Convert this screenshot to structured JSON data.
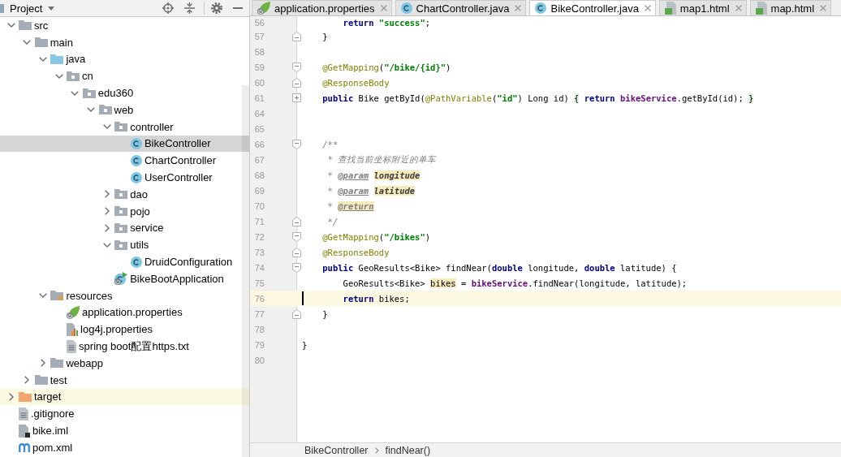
{
  "project_panel": {
    "title": "Project",
    "tree": [
      {
        "label": "src",
        "kind": "folder",
        "expanded": true,
        "selected": false,
        "children": [
          {
            "label": "main",
            "kind": "folder",
            "expanded": true,
            "selected": false,
            "children": [
              {
                "label": "java",
                "kind": "source-root",
                "expanded": true,
                "selected": false,
                "children": [
                  {
                    "label": "cn",
                    "kind": "package",
                    "expanded": true,
                    "selected": false,
                    "children": [
                      {
                        "label": "edu360",
                        "kind": "package",
                        "expanded": true,
                        "selected": false,
                        "children": [
                          {
                            "label": "web",
                            "kind": "package",
                            "expanded": true,
                            "selected": false,
                            "children": [
                              {
                                "label": "controller",
                                "kind": "package",
                                "expanded": true,
                                "selected": false,
                                "children": [
                                  {
                                    "label": "BikeController",
                                    "kind": "class",
                                    "selected": true
                                  },
                                  {
                                    "label": "ChartController",
                                    "kind": "class",
                                    "selected": false
                                  },
                                  {
                                    "label": "UserController",
                                    "kind": "class",
                                    "selected": false
                                  }
                                ]
                              },
                              {
                                "label": "dao",
                                "kind": "package",
                                "expanded": false,
                                "selected": false
                              },
                              {
                                "label": "pojo",
                                "kind": "package",
                                "expanded": false,
                                "selected": false
                              },
                              {
                                "label": "service",
                                "kind": "package",
                                "expanded": false,
                                "selected": false
                              },
                              {
                                "label": "utils",
                                "kind": "package",
                                "expanded": true,
                                "selected": false,
                                "children": [
                                  {
                                    "label": "DruidConfiguration",
                                    "kind": "class",
                                    "selected": false
                                  }
                                ]
                              },
                              {
                                "label": "BikeBootApplication",
                                "kind": "boot-app",
                                "selected": false
                              }
                            ]
                          }
                        ]
                      }
                    ]
                  }
                ]
              },
              {
                "label": "resources",
                "kind": "resources-root",
                "expanded": true,
                "selected": false,
                "children": [
                  {
                    "label": "application.properties",
                    "kind": "spring-properties",
                    "selected": false
                  },
                  {
                    "label": "log4j.properties",
                    "kind": "properties",
                    "selected": false
                  },
                  {
                    "label": "spring boot配置https.txt",
                    "kind": "text",
                    "selected": false
                  }
                ]
              },
              {
                "label": "webapp",
                "kind": "folder",
                "expanded": false,
                "selected": false
              }
            ]
          },
          {
            "label": "test",
            "kind": "folder",
            "expanded": false,
            "selected": false
          }
        ]
      },
      {
        "label": "target",
        "kind": "excluded-folder",
        "expanded": false,
        "selected": false
      },
      {
        "label": ".gitignore",
        "kind": "text",
        "selected": false
      },
      {
        "label": "bike.iml",
        "kind": "module",
        "selected": false
      },
      {
        "label": "pom.xml",
        "kind": "maven",
        "selected": false
      }
    ]
  },
  "editor": {
    "tabs": [
      {
        "label": "application.properties",
        "kind": "spring-properties",
        "selected": false
      },
      {
        "label": "ChartController.java",
        "kind": "class",
        "selected": false
      },
      {
        "label": "BikeController.java",
        "kind": "class",
        "selected": true
      },
      {
        "label": "map1.html",
        "kind": "html",
        "selected": false
      },
      {
        "label": "map.html",
        "kind": "html",
        "selected": false
      }
    ],
    "lines": [
      {
        "number": "56",
        "current": false,
        "tokens": [
          {
            "text": "        return ",
            "kind": "keyword"
          },
          {
            "text": "\"success\"",
            "kind": "string"
          },
          {
            "text": ";",
            "kind": "plain"
          }
        ]
      },
      {
        "number": "57",
        "fold": {
          "kind": "end"
        },
        "current": false,
        "tokens": [
          {
            "text": "    }",
            "kind": "plain"
          }
        ]
      },
      {
        "number": "58",
        "current": false
      },
      {
        "number": "59",
        "fold": {
          "kind": "start"
        },
        "current": false,
        "tokens": [
          {
            "text": "    @GetMapping",
            "kind": "annotation"
          },
          {
            "text": "(",
            "kind": "plain"
          },
          {
            "text": "\"/bike/{id}\"",
            "kind": "string"
          },
          {
            "text": ")",
            "kind": "plain"
          }
        ]
      },
      {
        "number": "60",
        "fold": {
          "kind": "end"
        },
        "current": false,
        "tokens": [
          {
            "text": "    @ResponseBody",
            "kind": "annotation"
          }
        ]
      },
      {
        "number": "61",
        "fold": {
          "kind": "collapsed"
        },
        "current": false,
        "tokens": [
          {
            "text": "    public",
            "kind": "keyword"
          },
          {
            "text": " Bike getById(",
            "kind": "plain"
          },
          {
            "text": "@PathVariable",
            "kind": "annotation"
          },
          {
            "text": "(",
            "kind": "plain"
          },
          {
            "text": "\"id\"",
            "kind": "string"
          },
          {
            "text": ") Long id) ",
            "kind": "plain"
          },
          {
            "text": "{",
            "kind": "fold-brace"
          },
          {
            "text": " return ",
            "kind": "keyword"
          },
          {
            "text": "bikeService",
            "kind": "field"
          },
          {
            "text": ".getById(id); ",
            "kind": "plain"
          },
          {
            "text": "}",
            "kind": "fold-brace"
          }
        ]
      },
      {
        "number": "64",
        "current": false
      },
      {
        "number": "65",
        "current": false
      },
      {
        "number": "66",
        "fold": {
          "kind": "start"
        },
        "current": false,
        "tokens": [
          {
            "text": "    /**",
            "kind": "comment"
          }
        ]
      },
      {
        "number": "67",
        "current": false,
        "tokens": [
          {
            "text": "     * 查找当前坐标附近的单车",
            "kind": "comment"
          }
        ]
      },
      {
        "number": "68",
        "current": false,
        "tokens": [
          {
            "text": "     * ",
            "kind": "comment"
          },
          {
            "text": "@param ",
            "kind": "doc-tag"
          },
          {
            "text": "longitude",
            "kind": "doc-param-warning"
          }
        ]
      },
      {
        "number": "69",
        "current": false,
        "tokens": [
          {
            "text": "     * ",
            "kind": "comment"
          },
          {
            "text": "@param ",
            "kind": "doc-tag"
          },
          {
            "text": "latitude",
            "kind": "doc-param-warning"
          }
        ]
      },
      {
        "number": "70",
        "current": false,
        "tokens": [
          {
            "text": "     * ",
            "kind": "comment"
          },
          {
            "text": "@return",
            "kind": "doc-tag-warning"
          }
        ]
      },
      {
        "number": "71",
        "fold": {
          "kind": "end"
        },
        "current": false,
        "tokens": [
          {
            "text": "     */",
            "kind": "comment"
          }
        ]
      },
      {
        "number": "72",
        "fold": {
          "kind": "start"
        },
        "current": false,
        "tokens": [
          {
            "text": "    @GetMapping",
            "kind": "annotation"
          },
          {
            "text": "(",
            "kind": "plain"
          },
          {
            "text": "\"/bikes\"",
            "kind": "string"
          },
          {
            "text": ")",
            "kind": "plain"
          }
        ]
      },
      {
        "number": "73",
        "fold": {
          "kind": "end"
        },
        "current": false,
        "tokens": [
          {
            "text": "    @ResponseBody",
            "kind": "annotation"
          }
        ]
      },
      {
        "number": "74",
        "fold": {
          "kind": "start"
        },
        "current": false,
        "tokens": [
          {
            "text": "    public",
            "kind": "keyword"
          },
          {
            "text": " GeoResults<Bike> findNear(",
            "kind": "plain"
          },
          {
            "text": "double",
            "kind": "keyword"
          },
          {
            "text": " longitude, ",
            "kind": "plain"
          },
          {
            "text": "double",
            "kind": "keyword"
          },
          {
            "text": " latitude) {",
            "kind": "plain"
          }
        ]
      },
      {
        "number": "75",
        "current": false,
        "tokens": [
          {
            "text": "        GeoResults<Bike> ",
            "kind": "plain"
          },
          {
            "text": "bikes",
            "kind": "warning"
          },
          {
            "text": " = ",
            "kind": "plain"
          },
          {
            "text": "bikeService",
            "kind": "field"
          },
          {
            "text": ".findNear(longitude, latitude);",
            "kind": "plain"
          }
        ]
      },
      {
        "number": "76",
        "current": true,
        "tokens": [
          {
            "text": "        return",
            "kind": "keyword"
          },
          {
            "text": " bikes;",
            "kind": "plain"
          }
        ]
      },
      {
        "number": "77",
        "fold": {
          "kind": "end"
        },
        "current": false,
        "tokens": [
          {
            "text": "    }",
            "kind": "plain"
          }
        ]
      },
      {
        "number": "78",
        "current": false
      },
      {
        "number": "79",
        "current": false,
        "tokens": [
          {
            "text": "}",
            "kind": "plain"
          }
        ]
      },
      {
        "number": "80",
        "current": false
      }
    ],
    "breadcrumbs": [
      "BikeController",
      "findNear()"
    ]
  }
}
